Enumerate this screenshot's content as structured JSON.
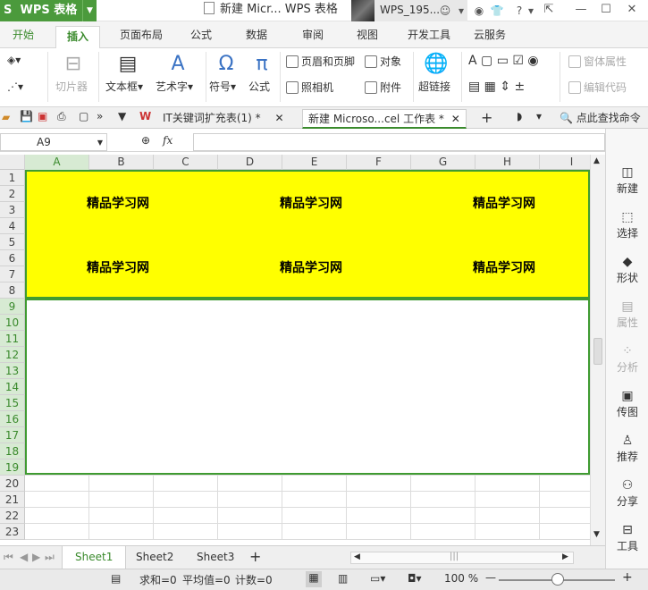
{
  "titlebar": {
    "app_name": "WPS 表格",
    "doc_title": "新建 Micr... WPS 表格",
    "username": "WPS_195..."
  },
  "ribbon_tabs": [
    "开始",
    "插入",
    "页面布局",
    "公式",
    "数据",
    "审阅",
    "视图",
    "开发工具",
    "云服务"
  ],
  "ribbon_active_tab": "插入",
  "ribbon": {
    "cutter": "切片器",
    "textbox": "文本框",
    "wordart": "艺术字",
    "symbol": "符号",
    "formula": "公式",
    "header_footer": "页眉和页脚",
    "object": "对象",
    "camera": "照相机",
    "attachment": "附件",
    "hyperlink": "超链接",
    "form_props": "窗体属性",
    "edit_code": "编辑代码"
  },
  "doc_tabs": [
    {
      "label": "IT关键词扩充表(1) *",
      "active": false
    },
    {
      "label": "新建 Microso...cel 工作表 *",
      "active": true
    }
  ],
  "find_command": "点此查找命令",
  "formula_bar": {
    "name_box": "A9",
    "fx_label": "fx",
    "value": ""
  },
  "columns": [
    "A",
    "B",
    "C",
    "D",
    "E",
    "F",
    "G",
    "H",
    "I"
  ],
  "rows": [
    "1",
    "2",
    "3",
    "4",
    "5",
    "6",
    "7",
    "8",
    "9",
    "10",
    "11",
    "12",
    "13",
    "14",
    "15",
    "16",
    "17",
    "18",
    "19",
    "20",
    "21",
    "22",
    "23"
  ],
  "cells": {
    "b3": "精品学习网",
    "e3": "精品学习网",
    "h3": "精品学习网",
    "b7": "精品学习网",
    "e7": "精品学习网",
    "h7": "精品学习网"
  },
  "side_panel": [
    "新建",
    "选择",
    "形状",
    "属性",
    "分析",
    "传图",
    "推荐",
    "分享",
    "工具"
  ],
  "sheets": [
    "Sheet1",
    "Sheet2",
    "Sheet3"
  ],
  "active_sheet": "Sheet1",
  "status": {
    "sum": "求和=0",
    "avg": "平均值=0",
    "count": "计数=0",
    "zoom": "100 %"
  },
  "colors": {
    "accent": "#3a8a2c",
    "fill": "#ffff00"
  }
}
